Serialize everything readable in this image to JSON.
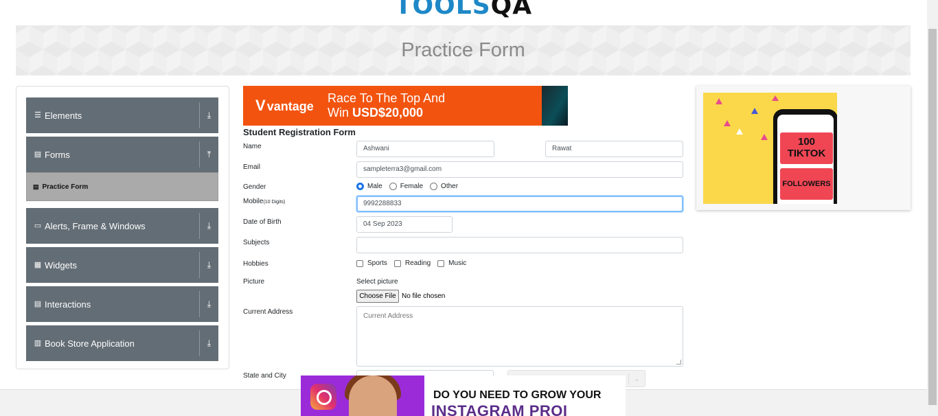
{
  "logo": {
    "part1": "TOOLS",
    "part2": "QA"
  },
  "page": {
    "title": "Practice Form"
  },
  "sidebar": {
    "groups": [
      {
        "label": "Elements",
        "icon": "menu-icon",
        "arrow": "expand-arrow"
      },
      {
        "label": "Forms",
        "icon": "form-icon",
        "arrow": "collapse-arrow"
      },
      {
        "label": "Alerts, Frame & Windows",
        "icon": "window-icon",
        "arrow": "expand-arrow"
      },
      {
        "label": "Widgets",
        "icon": "widgets-icon",
        "arrow": "expand-arrow"
      },
      {
        "label": "Interactions",
        "icon": "interactions-icon",
        "arrow": "expand-arrow"
      },
      {
        "label": "Book Store Application",
        "icon": "bookstore-icon",
        "arrow": "expand-arrow"
      }
    ],
    "active_item": "Practice Form"
  },
  "ad_top": {
    "brand": "vantage",
    "line1": "Race To The Top And",
    "line2_prefix": "Win ",
    "line2_bold": "USD$20,000"
  },
  "form": {
    "title": "Student Registration Form",
    "name_label": "Name",
    "first_name": "Ashwani",
    "last_name": "Rawat",
    "email_label": "Email",
    "email": "sampleterra3@gmail.com",
    "gender_label": "Gender",
    "gender_options": [
      "Male",
      "Female",
      "Other"
    ],
    "gender_selected": "Male",
    "mobile_label": "Mobile",
    "mobile_hint": "(10 Digits)",
    "mobile": "9992288833",
    "dob_label": "Date of Birth",
    "dob": "04 Sep 2023",
    "subjects_label": "Subjects",
    "hobbies_label": "Hobbies",
    "hobbies": [
      "Sports",
      "Reading",
      "Music"
    ],
    "picture_label": "Picture",
    "select_picture": "Select picture",
    "choose_file": "Choose File",
    "no_file": "No file chosen",
    "address_label": "Current Address",
    "address_placeholder": "Current Address",
    "state_city_label": "State and City"
  },
  "ad_right": {
    "line1": "100",
    "line2": "TIKTOK",
    "line3": "FOLLOWERS"
  },
  "ad_bottom": {
    "line1": "DO YOU NEED TO GROW YOUR",
    "line2": "INSTAGRAM PROI"
  },
  "colors": {
    "sidebar_bg": "#636d75",
    "active_bg": "#aaaaaa",
    "accent": "#1a73e8",
    "focus_border": "#80bdff"
  }
}
